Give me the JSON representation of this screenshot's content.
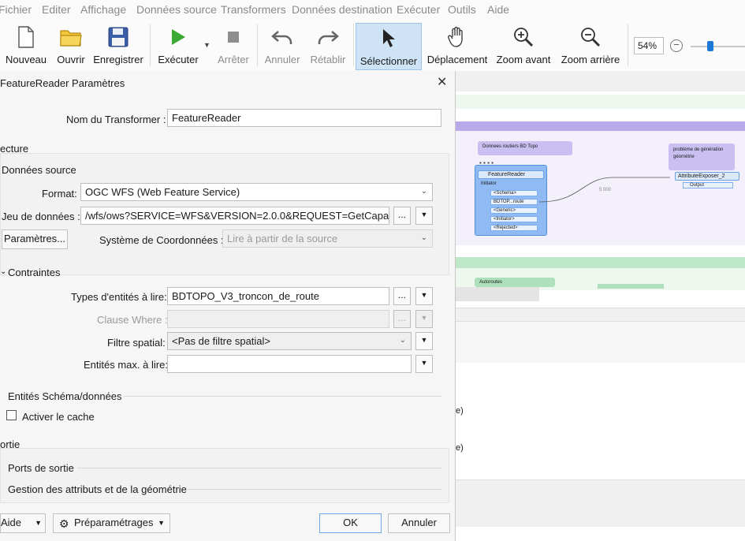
{
  "menu": [
    "Fichier",
    "Editer",
    "Affichage",
    "Données source",
    "Transformers",
    "Données destination",
    "Exécuter",
    "Outils",
    "Aide"
  ],
  "toolbar": {
    "new": "Nouveau",
    "open": "Ouvrir",
    "save": "Enregistrer",
    "run": "Exécuter",
    "stop": "Arrêter",
    "undo": "Annuler",
    "redo": "Rétablir",
    "select": "Sélectionner",
    "pan": "Déplacement",
    "zoom_in": "Zoom avant",
    "zoom_out": "Zoom arrière",
    "zoom_level": "54%"
  },
  "dialog": {
    "title": "FeatureReader Paramètres",
    "name_label": "Nom du Transformer :",
    "name_value": "FeatureReader",
    "section_read": "ecture",
    "group_source": "Données source",
    "format_label": "Format:",
    "format_value": "OGC WFS (Web Feature Service)",
    "dataset_label": "Jeu de données :",
    "dataset_value": "/wfs/ows?SERVICE=WFS&VERSION=2.0.0&REQUEST=GetCapabilities",
    "params_button": "Paramètres...",
    "crs_label": "Système de Coordonnées :",
    "crs_placeholder": "Lire à partir de la source",
    "constraints_label": "Contraintes",
    "types_label": "Types d'entités à lire:",
    "types_value": "BDTOPO_V3_troncon_de_route",
    "where_label": "Clause Where :",
    "spatial_label": "Filtre spatial:",
    "spatial_value": "<Pas de filtre spatial>",
    "max_label": "Entités max. à lire:",
    "max_value": "",
    "schema_label": "Entités Schéma/données",
    "cache_label": "Activer le cache",
    "section_output": "ortie",
    "ports_label": "Ports de sortie",
    "attr_label": "Gestion des attributs et de la géométrie",
    "help_button": "Aide",
    "presets_button": "Préparamétrages",
    "ok_button": "OK",
    "cancel_button": "Annuler",
    "ellipsis": "..."
  },
  "canvas": {
    "bookmark_roads": "Donnees routiers BD Topo",
    "bookmark_problem": "problème de génération géométrie",
    "bookmark_highways": "Autoroutes",
    "reader_name": "FeatureReader",
    "reader_ports": [
      "Initiator",
      "<Schema>",
      "BDTOP...route",
      "<Generic>",
      "<Initiator>",
      "<Rejected>"
    ],
    "exposer_name": "AttributeExposer_2",
    "exposer_port": "Output",
    "link_count_1": "5 000",
    "link_count_2": "5 000",
    "log_frag_1": "e)",
    "log_frag_2": "e)"
  },
  "colors": {
    "accent": "#cfe3f7",
    "purple": "#b9a9e8",
    "green": "#bfe8c9",
    "reader": "#7aaef0"
  }
}
